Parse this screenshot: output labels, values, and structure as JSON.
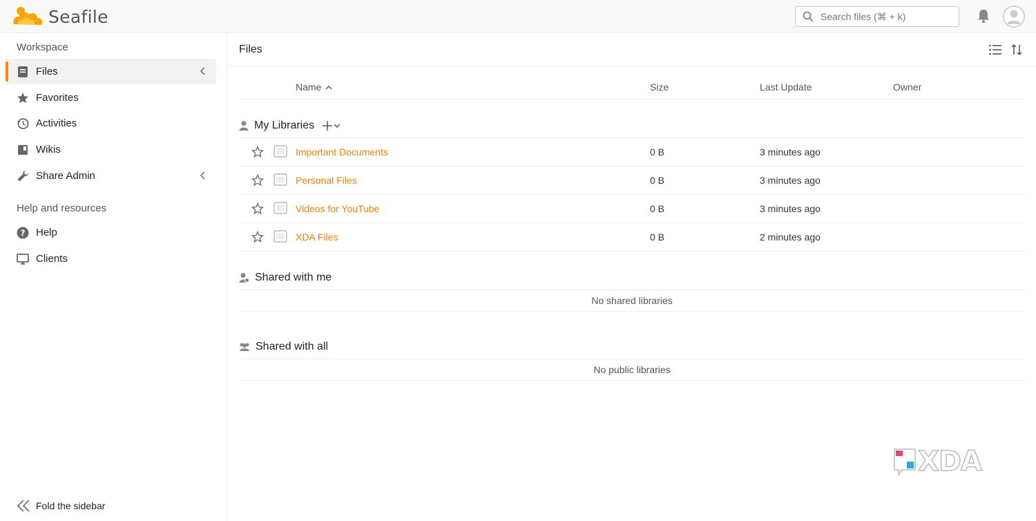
{
  "header": {
    "logo_text": "Seafile",
    "search_placeholder": "Search files (⌘ + k)"
  },
  "sidebar": {
    "workspace_title": "Workspace",
    "items": [
      {
        "label": "Files",
        "icon": "files-icon",
        "active": true
      },
      {
        "label": "Favorites",
        "icon": "star-icon"
      },
      {
        "label": "Activities",
        "icon": "history-icon"
      },
      {
        "label": "Wikis",
        "icon": "wiki-icon"
      },
      {
        "label": "Share Admin",
        "icon": "wrench-icon"
      }
    ],
    "help_title": "Help and resources",
    "help_items": [
      {
        "label": "Help",
        "icon": "help-icon"
      },
      {
        "label": "Clients",
        "icon": "monitor-icon"
      }
    ],
    "fold_label": "Fold the sidebar"
  },
  "main": {
    "title": "Files",
    "columns": {
      "name": "Name",
      "size": "Size",
      "last_update": "Last Update",
      "owner": "Owner"
    },
    "my_libraries": {
      "title": "My Libraries",
      "rows": [
        {
          "name": "Important Documents",
          "size": "0 B",
          "updated": "3 minutes ago"
        },
        {
          "name": "Personal Files",
          "size": "0 B",
          "updated": "3 minutes ago"
        },
        {
          "name": "Videos for YouTube",
          "size": "0 B",
          "updated": "3 minutes ago"
        },
        {
          "name": "XDA Files",
          "size": "0 B",
          "updated": "2 minutes ago"
        }
      ]
    },
    "shared_with_me": {
      "title": "Shared with me",
      "empty": "No shared libraries"
    },
    "shared_with_all": {
      "title": "Shared with all",
      "empty": "No public libraries"
    }
  },
  "watermark": "XDA",
  "colors": {
    "accent": "#ff8c00",
    "link": "#eb8205"
  }
}
